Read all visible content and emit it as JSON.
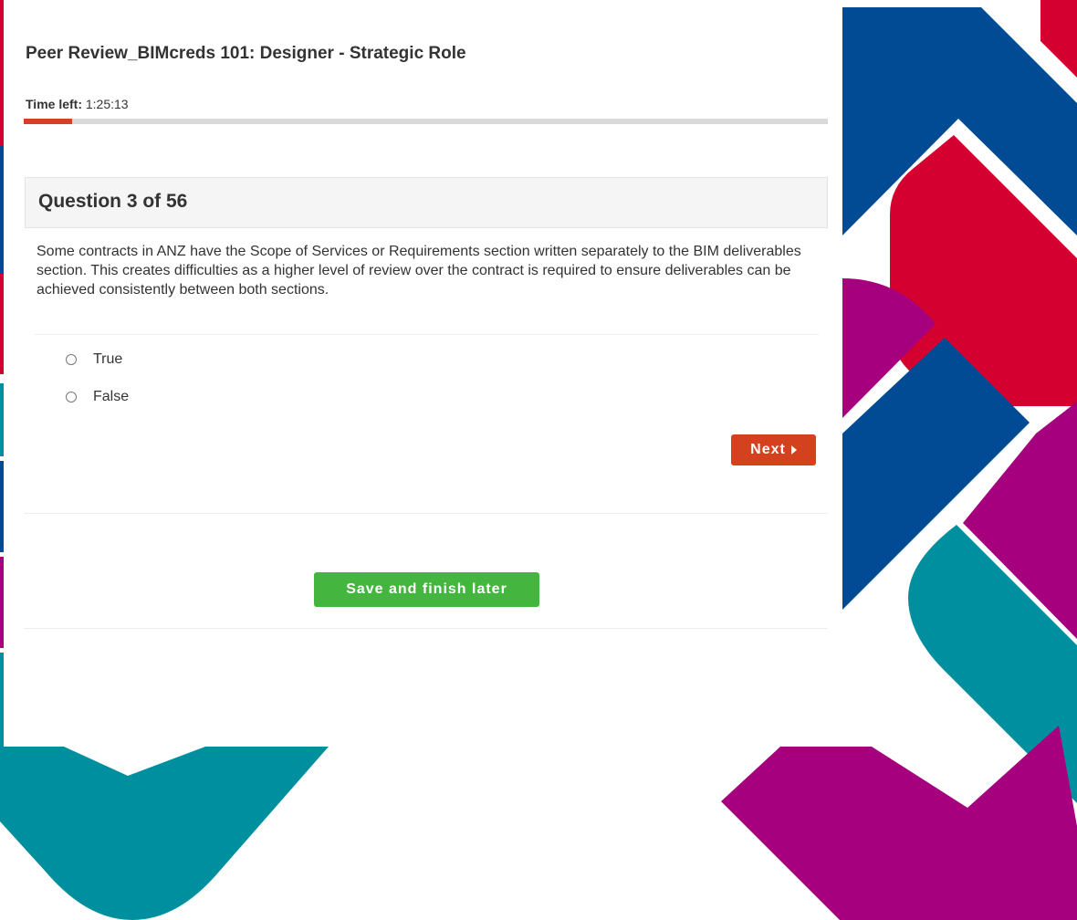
{
  "quiz": {
    "title": "Peer Review_BIMcreds 101: Designer - Strategic Role",
    "time_left_label": "Time left:",
    "time_left_value": "1:25:13",
    "progress_fraction": 0.06
  },
  "question": {
    "header": "Question 3 of 56",
    "text": "Some contracts in ANZ have the Scope of Services or Requirements section written separately to the BIM deliverables section. This creates difficulties as a higher level of review over the contract is required to ensure deliverables can be achieved consistently between both sections.",
    "options": [
      "True",
      "False"
    ]
  },
  "actions": {
    "next_label": "Next",
    "save_label": "Save and finish later"
  },
  "colors": {
    "accent": "#d4411e",
    "save_button": "#44b63f",
    "background_shapes": [
      "#d4002f",
      "#004b93",
      "#a6007e",
      "#008f9e"
    ]
  },
  "icons": {
    "next": "caret-right-icon",
    "option": "radio-circle-icon"
  }
}
